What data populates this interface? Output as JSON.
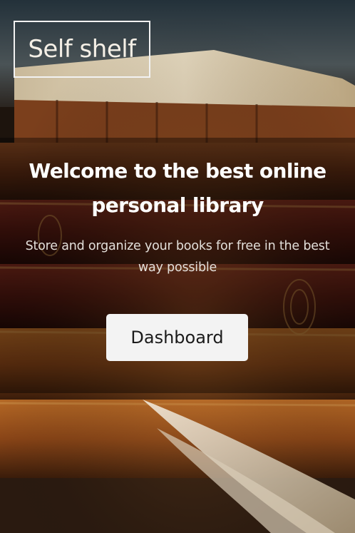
{
  "header": {
    "logo_text": "Self shelf"
  },
  "hero": {
    "headline": "Welcome to the best online personal library",
    "subheadline": "Store and organize your books for free in the best way possible",
    "cta_label": "Dashboard"
  }
}
